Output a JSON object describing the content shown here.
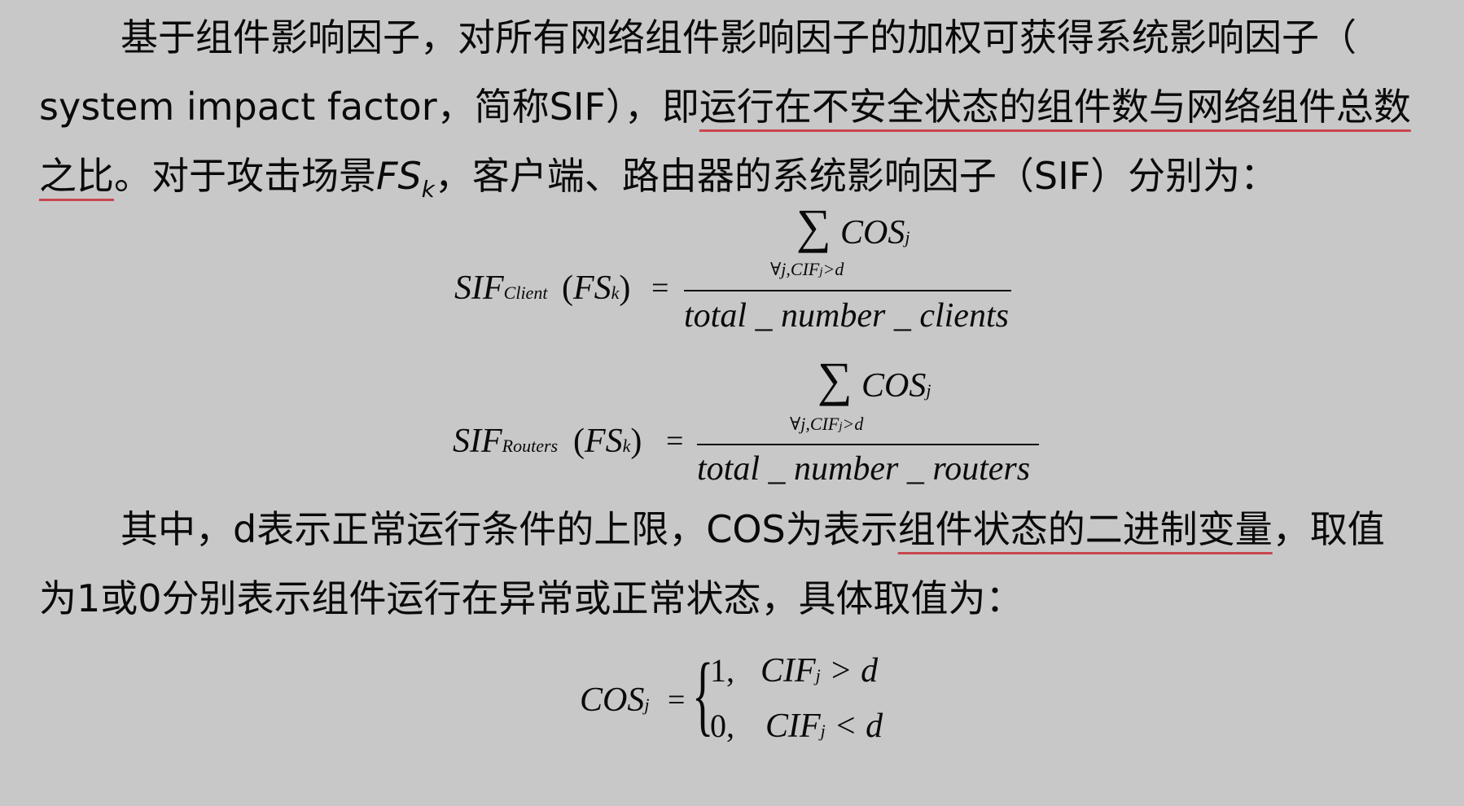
{
  "paragraph1": {
    "line1": "基于组件影响因子，对所有网络组件影响因子的加权可获得系统影响因子（",
    "line2_pre": "system impact factor，简称SIF），即",
    "line2_underlined": "运行在不安全状态的组件数与网络组件总数",
    "line3_underlined": "之比",
    "line3_mid": "。对于攻击场景",
    "line3_var": "FS",
    "line3_var_sub": "k",
    "line3_post": "，客户端、路由器的系统影响因子（SIF）分别为："
  },
  "formula_client": {
    "lhs": "SIF",
    "lhs_sub": "Client",
    "arg_open": "(",
    "arg": "FS",
    "arg_sub": "k",
    "arg_close": ")",
    "eq": "=",
    "sum_symbol": "∑",
    "numerator": "COS",
    "numerator_sub": "j",
    "sum_condition": "∀j,CIF",
    "sum_condition_sub": "j",
    "sum_condition_tail": ">d",
    "denominator": "total _ number _ clients"
  },
  "formula_routers": {
    "lhs": "SIF",
    "lhs_sub": "Routers",
    "arg_open": "(",
    "arg": "FS",
    "arg_sub": "k",
    "arg_close": ")",
    "eq": "=",
    "sum_symbol": "∑",
    "numerator": "COS",
    "numerator_sub": "j",
    "sum_condition": "∀j,CIF",
    "sum_condition_sub": "j",
    "sum_condition_tail": ">d",
    "denominator": "total _ number _ routers"
  },
  "paragraph2": {
    "line1_pre": "其中，d表示正常运行条件的上限，COS为表示",
    "line1_underlined": "组件状态的二进制变量",
    "line1_post": "，取值",
    "line2": "为1或0分别表示组件运行在异常或正常状态，具体取值为："
  },
  "formula_cos": {
    "lhs": "COS",
    "lhs_sub": "j",
    "eq": "=",
    "brace": "{",
    "case1_value": "1,",
    "case1_cond": "CIF",
    "case1_cond_sub": "j",
    "case1_rel": "> d",
    "case2_value": "0,",
    "case2_cond": "CIF",
    "case2_cond_sub": "j",
    "case2_rel": "< d"
  }
}
